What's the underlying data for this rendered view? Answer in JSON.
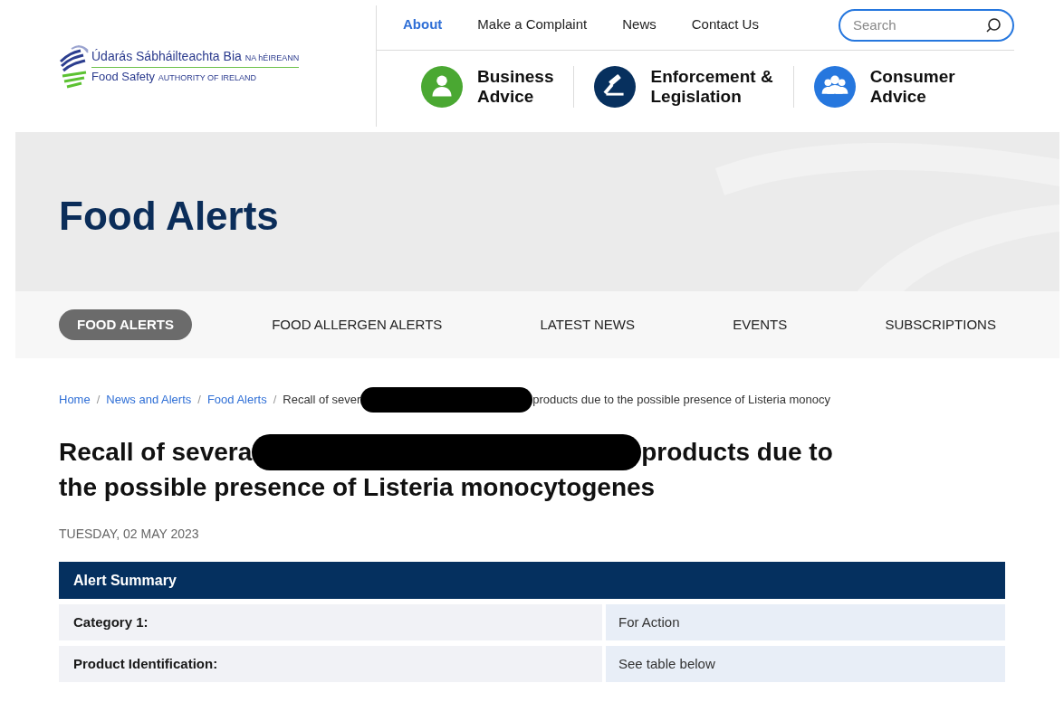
{
  "logo": {
    "line_1": "Údarás Sábháilteachta Bia",
    "line_1_small": "NA hÉIREANN",
    "line_2": "Food Safety",
    "line_2_small": "AUTHORITY OF IRELAND"
  },
  "top_nav": [
    {
      "label": "About",
      "selected": true
    },
    {
      "label": "Make a Complaint",
      "selected": false
    },
    {
      "label": "News",
      "selected": false
    },
    {
      "label": "Contact Us",
      "selected": false
    }
  ],
  "search": {
    "placeholder": "Search"
  },
  "categories": [
    {
      "kind": "person",
      "color": "#4aa832",
      "line_1": "Business",
      "line_2": "Advice"
    },
    {
      "kind": "gavel",
      "color": "#07305e",
      "line_1": "Enforcement &",
      "line_2": "Legislation"
    },
    {
      "kind": "group",
      "color": "#2677de",
      "line_1": "Consumer",
      "line_2": "Advice"
    }
  ],
  "hero": {
    "title": "Food Alerts"
  },
  "section_tabs": [
    {
      "label": "FOOD ALERTS",
      "selected": true
    },
    {
      "label": "FOOD ALLERGEN ALERTS",
      "selected": false
    },
    {
      "label": "LATEST NEWS",
      "selected": false
    },
    {
      "label": "EVENTS",
      "selected": false
    },
    {
      "label": "SUBSCRIPTIONS",
      "selected": false
    }
  ],
  "breadcrumb": {
    "links": [
      "Home",
      "News and Alerts",
      "Food Alerts"
    ],
    "separator": "/",
    "current_before": "Recall of sever",
    "current_after": "products due to the possible presence of Listeria monocy"
  },
  "article": {
    "title_before": "Recall of severa",
    "title_after": "products due to",
    "title_line_2": "the possible presence of Listeria monocytogenes",
    "date": "TUESDAY, 02 MAY 2023"
  },
  "summary_table": {
    "title": "Alert Summary",
    "rows": [
      {
        "label": "Category 1:",
        "value": "For Action"
      },
      {
        "label": "Product Identification:",
        "value": "See table below"
      }
    ]
  }
}
